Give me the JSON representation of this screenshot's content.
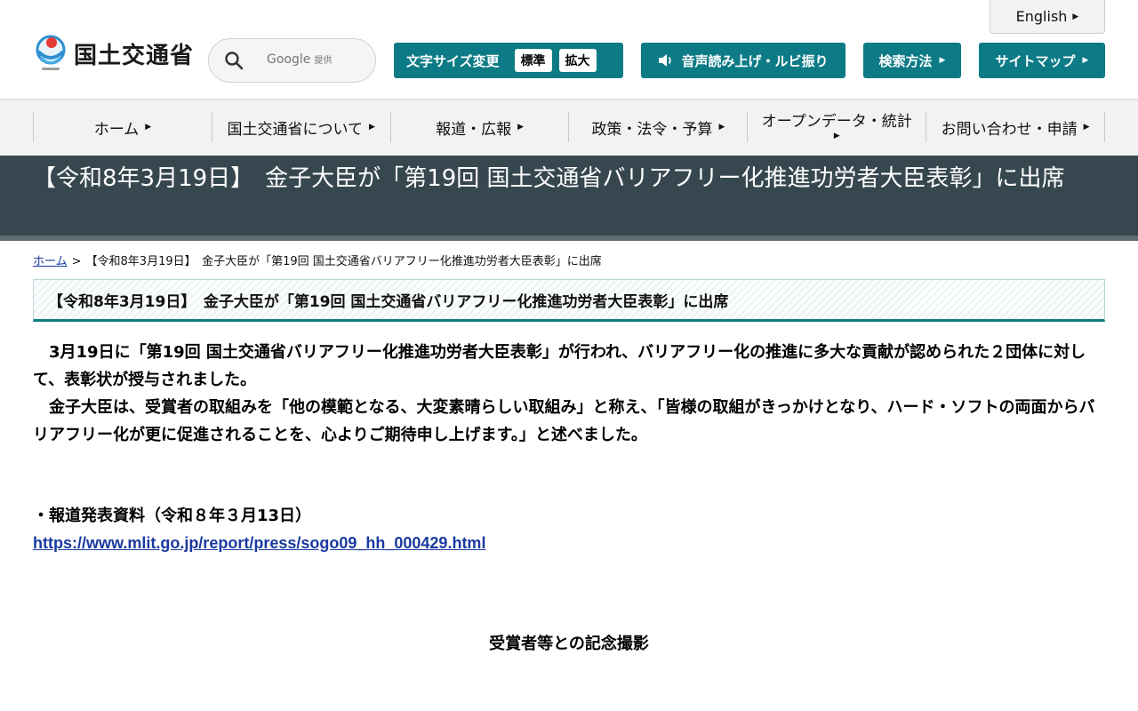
{
  "header": {
    "english_label": "English",
    "logo_text": "国土交通省",
    "search": {
      "placeholder": "",
      "brand": "Google",
      "brand_suffix": "提供"
    },
    "text_size": {
      "label": "文字サイズ変更",
      "options": [
        "標準",
        "拡大"
      ]
    },
    "voice_label": "音声読み上げ・ルビ振り",
    "search_method_label": "検索方法",
    "sitemap_label": "サイトマップ"
  },
  "gnav": {
    "items": [
      "ホーム",
      "国土交通省について",
      "報道・広報",
      "政策・法令・予算",
      "オープンデータ・統計",
      "お問い合わせ・申請"
    ]
  },
  "page": {
    "title": "【令和8年3月19日】　金子大臣が「第19回 国土交通省バリアフリー化推進功労者大臣表彰」に出席",
    "breadcrumb": {
      "home": "ホーム",
      "sep": ">",
      "current": "【令和8年3月19日】　金子大臣が「第19回 国土交通省バリアフリー化推進功労者大臣表彰」に出席"
    },
    "heading": "【令和8年3月19日】　金子大臣が「第19回 国土交通省バリアフリー化推進功労者大臣表彰」に出席",
    "paragraphs": [
      "3月19日に「第19回 国土交通省バリアフリー化推進功労者大臣表彰」が行われ、バリアフリー化の推進に多大な貢献が認められた２団体に対して、表彰状が授与されました。",
      "金子大臣は、受賞者の取組みを「他の模範となる、大変素晴らしい取組み」と称え、「皆様の取組がきっかけとなり、ハード・ソフトの両面からバリアフリー化が更に促進されることを、心よりご期待申し上げます。」と述べました。"
    ],
    "press_label": "・報道発表資料（令和８年３月13日）",
    "press_link": "https://www.mlit.go.jp/report/press/sogo09_hh_000429.html",
    "photo_caption": "受賞者等との記念撮影"
  },
  "colors": {
    "accent": "#0d7b86",
    "title_band": "#37474f",
    "link": "#1a3aa0"
  }
}
